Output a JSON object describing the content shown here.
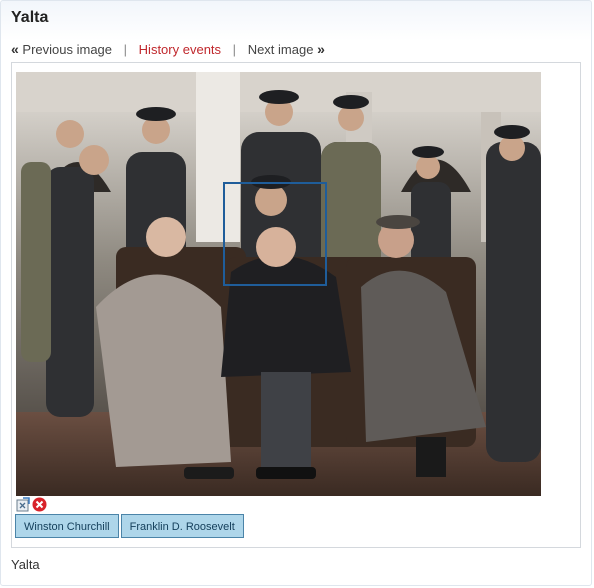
{
  "page": {
    "title": "Yalta"
  },
  "nav": {
    "prev_arrow": "«",
    "prev_label": "Previous image",
    "separator": "|",
    "history_label": "History events",
    "next_label": "Next image",
    "next_arrow": "»"
  },
  "tools": {
    "edit_icon": "edit-tag-icon",
    "delete_icon": "delete-tag-icon"
  },
  "tags": [
    {
      "label": "Winston Churchill"
    },
    {
      "label": "Franklin D. Roosevelt"
    }
  ],
  "caption": "Yalta",
  "colors": {
    "accent_red": "#c0282d",
    "tag_border": "#1f5d9a",
    "tag_button_bg": "#aed6ea"
  }
}
